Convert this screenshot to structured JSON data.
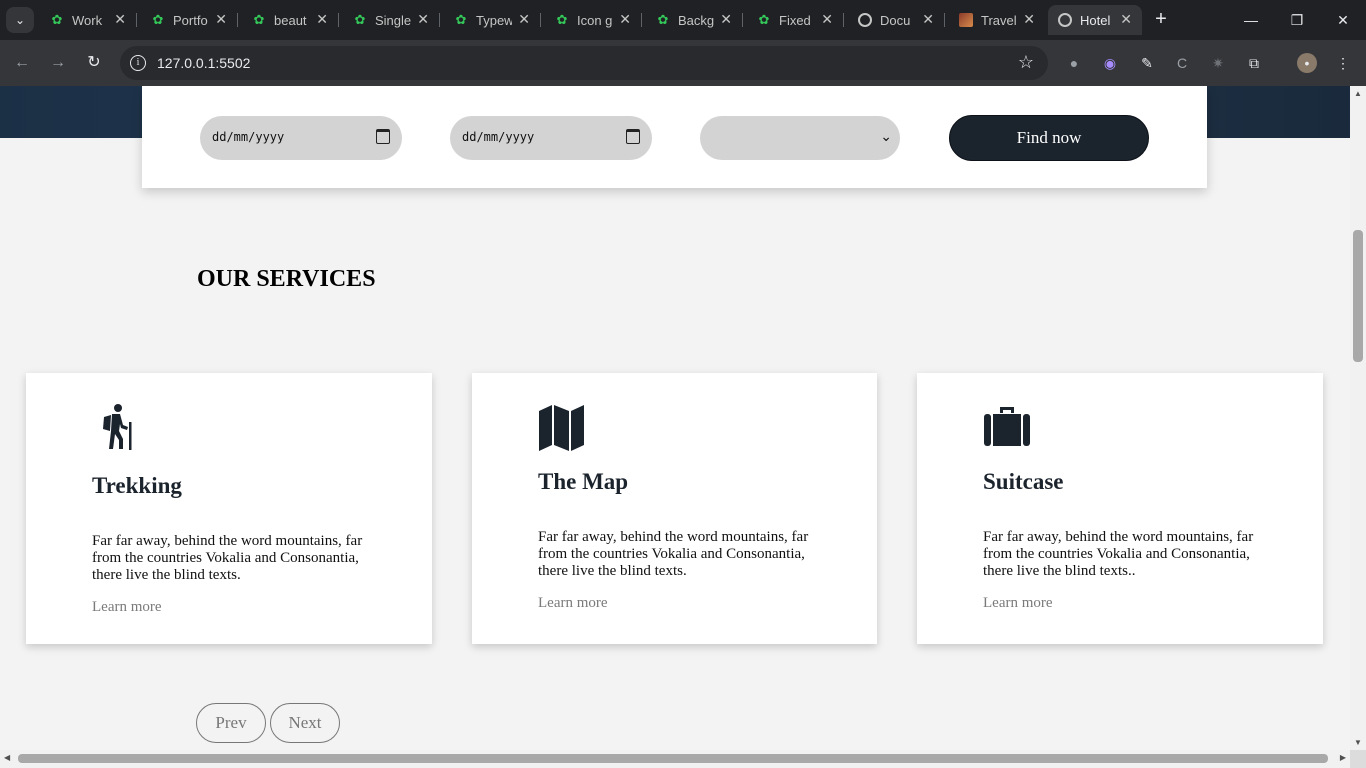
{
  "browser": {
    "tabs": [
      {
        "title": "Work",
        "favicon": "clover-icon"
      },
      {
        "title": "Portfo",
        "favicon": "clover-icon"
      },
      {
        "title": "beaut",
        "favicon": "clover-icon"
      },
      {
        "title": "Single",
        "favicon": "clover-icon"
      },
      {
        "title": "Typew",
        "favicon": "clover-icon"
      },
      {
        "title": "Icon g",
        "favicon": "clover-icon"
      },
      {
        "title": "Backg",
        "favicon": "clover-icon"
      },
      {
        "title": "Fixed",
        "favicon": "clover-icon"
      },
      {
        "title": "Docu",
        "favicon": "globe-icon"
      },
      {
        "title": "Travel",
        "favicon": "image-icon"
      },
      {
        "title": "Hotel",
        "favicon": "globe-icon",
        "active": true
      }
    ],
    "url": "127.0.0.1:5502"
  },
  "search_form": {
    "check_in": "dd/mm/yyyy",
    "check_out": "dd/mm/yyyy",
    "select_value": "",
    "find_label": "Find now"
  },
  "services": {
    "title": "OUR SERVICES",
    "cards": [
      {
        "icon": "hiking-icon",
        "title": "Trekking",
        "text": "Far far away, behind the word mountains, far from the countries Vokalia and Consonantia, there live the blind texts.",
        "link": "Learn more"
      },
      {
        "icon": "map-icon",
        "title": "The Map",
        "text": "Far far away, behind the word mountains, far from the countries Vokalia and Consonantia, there live the blind texts.",
        "link": "Learn more"
      },
      {
        "icon": "suitcase-icon",
        "title": "Suitcase",
        "text": "Far far away, behind the word mountains, far from the countries Vokalia and Consonantia, there live the blind texts..",
        "link": "Learn more"
      }
    ]
  },
  "pagination": {
    "prev": "Prev",
    "next": "Next"
  },
  "colors": {
    "accent_dark": "#1b232d",
    "page_bg": "#f3f3f3",
    "input_bg": "#d3d3d3"
  }
}
